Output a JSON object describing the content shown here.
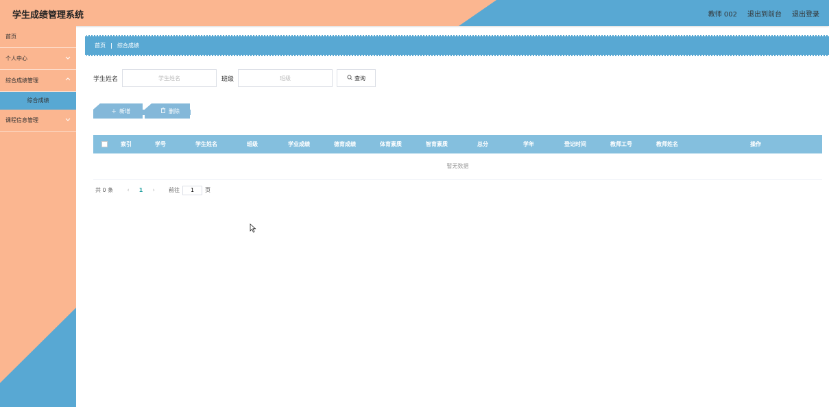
{
  "header": {
    "title": "学生成绩管理系统",
    "user": "教师 002",
    "front_link": "退出到前台",
    "logout": "退出登录",
    "bg_color": "#fbb690",
    "accent_color": "#58a8d3"
  },
  "sidebar": {
    "items": [
      {
        "label": "首页"
      },
      {
        "label": "个人中心"
      },
      {
        "label": "综合成绩管理"
      },
      {
        "label": "综合成绩"
      },
      {
        "label": "课程信息管理"
      }
    ],
    "chevron_icon": "chevron-down-icon"
  },
  "breadcrumb": {
    "home": "首页",
    "separator": "|",
    "current": "综合成绩"
  },
  "search": {
    "name_label": "学生姓名",
    "name_placeholder": "学生姓名",
    "class_label": "班级",
    "class_placeholder": "班级",
    "button_label": "查询",
    "button_icon": "search-icon"
  },
  "actions": {
    "add_label": "新增",
    "add_icon": "plus-icon",
    "delete_label": "删除",
    "delete_icon": "trash-icon"
  },
  "table": {
    "columns": [
      "索引",
      "学号",
      "学生姓名",
      "班级",
      "学业成绩",
      "德育成绩",
      "体育素质",
      "智育素质",
      "总分",
      "学年",
      "登记时间",
      "教师工号",
      "教师姓名",
      "操作"
    ],
    "empty_text": "暂无数据",
    "header_color": "#84bfde"
  },
  "pagination": {
    "total": "共 0 条",
    "current_page": "1",
    "goto_label": "前往",
    "goto_value": "1",
    "page_unit": "页"
  }
}
